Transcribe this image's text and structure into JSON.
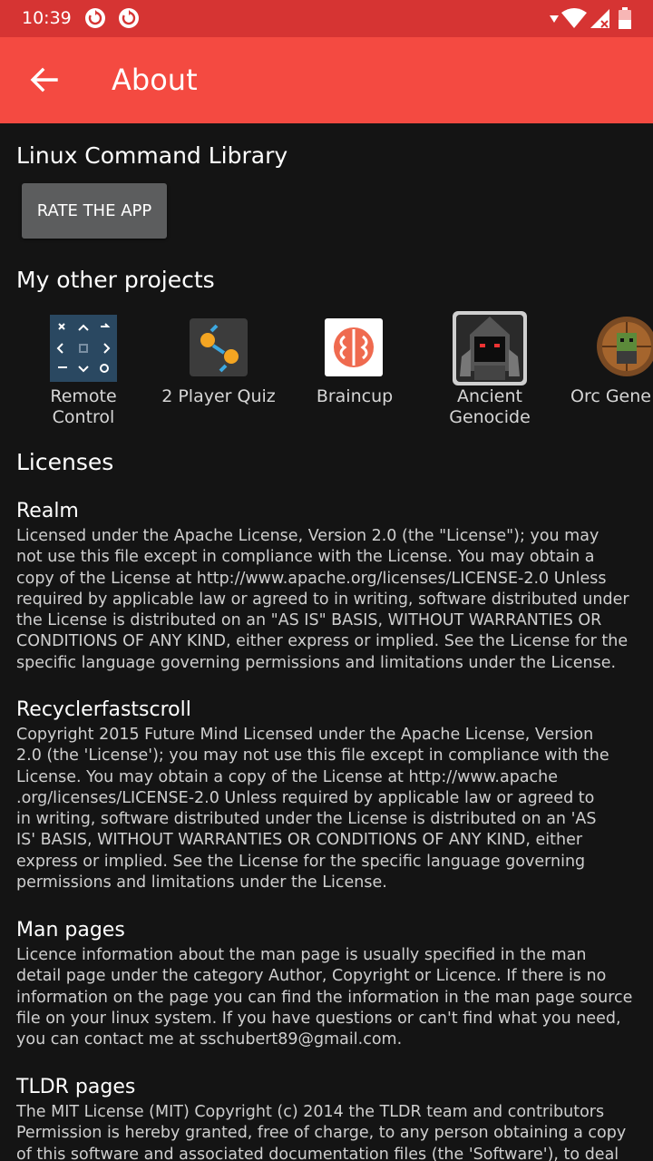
{
  "status_bar": {
    "time": "10:39",
    "icons": [
      "sync-icon",
      "sync-icon",
      "wifi-icon",
      "signal-icon",
      "battery-icon"
    ]
  },
  "app_bar": {
    "title": "About",
    "back_icon": "arrow-back-icon"
  },
  "app_name": "Linux Command Library",
  "rate_button": "RATE THE APP",
  "projects_title": "My other projects",
  "projects": [
    {
      "label": "Remote\nControl",
      "icon": "remote-control-icon"
    },
    {
      "label": "2 Player Quiz",
      "icon": "quiz-icon"
    },
    {
      "label": "Braincup",
      "icon": "brain-icon"
    },
    {
      "label": "Ancient\nGenocide",
      "icon": "ancient-genocide-icon"
    },
    {
      "label": "Orc Gene",
      "icon": "orc-icon"
    }
  ],
  "licenses_title": "Licenses",
  "licenses": [
    {
      "name": "Realm",
      "lines": [
        "Licensed under the Apache License, Version 2.0 (the \"License\"); you may",
        "not use this file except in compliance with the License. You may obtain a",
        "copy of the License at http://www.apache.org/licenses/LICENSE-2.0 Unless",
        "required by applicable law or agreed to in writing, software distributed under",
        "the License is distributed on an \"AS IS\" BASIS, WITHOUT WARRANTIES OR",
        "CONDITIONS OF ANY KIND, either express or implied. See the License for the",
        "specific language governing permissions and limitations under the License."
      ]
    },
    {
      "name": "Recyclerfastscroll",
      "lines": [
        "Copyright 2015 Future Mind  Licensed under the Apache License, Version",
        "2.0 (the 'License'); you may not use this file except in compliance with the",
        "License. You may obtain a copy of the License at     http://www.apache",
        ".org/licenses/LICENSE-2.0  Unless required by applicable law or agreed to",
        "in writing, software distributed under the License is distributed on an 'AS",
        "IS' BASIS, WITHOUT WARRANTIES OR CONDITIONS OF ANY KIND, either",
        "express or implied. See the License for the specific language governing",
        "permissions and limitations under the License."
      ]
    },
    {
      "name": "Man pages",
      "lines": [
        "Licence information about the man page is usually specified in the man",
        "detail page under the category Author, Copyright or Licence. If there is no",
        "information on the page you can find the information in the man page source",
        "file on your linux system. If you have questions or can't find what you need,",
        "you can contact me at sschubert89@gmail.com."
      ]
    },
    {
      "name": "TLDR pages",
      "lines": [
        "The MIT License (MIT) Copyright (c) 2014 the TLDR team and contributors",
        "Permission is hereby granted, free of charge, to any person obtaining a copy",
        "of this software and associated documentation files (the 'Software'), to deal"
      ]
    }
  ]
}
